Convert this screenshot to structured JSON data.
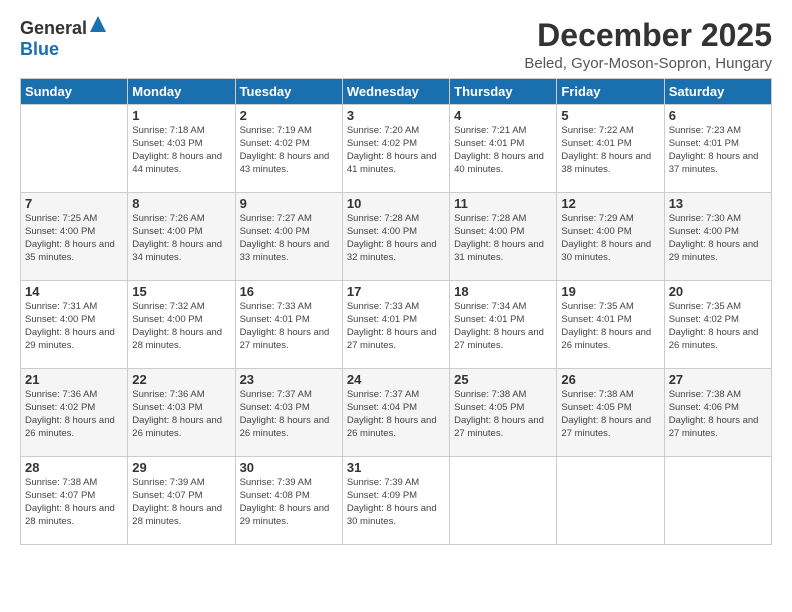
{
  "logo": {
    "general": "General",
    "blue": "Blue"
  },
  "title": "December 2025",
  "location": "Beled, Gyor-Moson-Sopron, Hungary",
  "weekdays": [
    "Sunday",
    "Monday",
    "Tuesday",
    "Wednesday",
    "Thursday",
    "Friday",
    "Saturday"
  ],
  "weeks": [
    [
      {
        "day": "",
        "sunrise": "",
        "sunset": "",
        "daylight": ""
      },
      {
        "day": "1",
        "sunrise": "Sunrise: 7:18 AM",
        "sunset": "Sunset: 4:03 PM",
        "daylight": "Daylight: 8 hours and 44 minutes."
      },
      {
        "day": "2",
        "sunrise": "Sunrise: 7:19 AM",
        "sunset": "Sunset: 4:02 PM",
        "daylight": "Daylight: 8 hours and 43 minutes."
      },
      {
        "day": "3",
        "sunrise": "Sunrise: 7:20 AM",
        "sunset": "Sunset: 4:02 PM",
        "daylight": "Daylight: 8 hours and 41 minutes."
      },
      {
        "day": "4",
        "sunrise": "Sunrise: 7:21 AM",
        "sunset": "Sunset: 4:01 PM",
        "daylight": "Daylight: 8 hours and 40 minutes."
      },
      {
        "day": "5",
        "sunrise": "Sunrise: 7:22 AM",
        "sunset": "Sunset: 4:01 PM",
        "daylight": "Daylight: 8 hours and 38 minutes."
      },
      {
        "day": "6",
        "sunrise": "Sunrise: 7:23 AM",
        "sunset": "Sunset: 4:01 PM",
        "daylight": "Daylight: 8 hours and 37 minutes."
      }
    ],
    [
      {
        "day": "7",
        "sunrise": "Sunrise: 7:25 AM",
        "sunset": "Sunset: 4:00 PM",
        "daylight": "Daylight: 8 hours and 35 minutes."
      },
      {
        "day": "8",
        "sunrise": "Sunrise: 7:26 AM",
        "sunset": "Sunset: 4:00 PM",
        "daylight": "Daylight: 8 hours and 34 minutes."
      },
      {
        "day": "9",
        "sunrise": "Sunrise: 7:27 AM",
        "sunset": "Sunset: 4:00 PM",
        "daylight": "Daylight: 8 hours and 33 minutes."
      },
      {
        "day": "10",
        "sunrise": "Sunrise: 7:28 AM",
        "sunset": "Sunset: 4:00 PM",
        "daylight": "Daylight: 8 hours and 32 minutes."
      },
      {
        "day": "11",
        "sunrise": "Sunrise: 7:28 AM",
        "sunset": "Sunset: 4:00 PM",
        "daylight": "Daylight: 8 hours and 31 minutes."
      },
      {
        "day": "12",
        "sunrise": "Sunrise: 7:29 AM",
        "sunset": "Sunset: 4:00 PM",
        "daylight": "Daylight: 8 hours and 30 minutes."
      },
      {
        "day": "13",
        "sunrise": "Sunrise: 7:30 AM",
        "sunset": "Sunset: 4:00 PM",
        "daylight": "Daylight: 8 hours and 29 minutes."
      }
    ],
    [
      {
        "day": "14",
        "sunrise": "Sunrise: 7:31 AM",
        "sunset": "Sunset: 4:00 PM",
        "daylight": "Daylight: 8 hours and 29 minutes."
      },
      {
        "day": "15",
        "sunrise": "Sunrise: 7:32 AM",
        "sunset": "Sunset: 4:00 PM",
        "daylight": "Daylight: 8 hours and 28 minutes."
      },
      {
        "day": "16",
        "sunrise": "Sunrise: 7:33 AM",
        "sunset": "Sunset: 4:01 PM",
        "daylight": "Daylight: 8 hours and 27 minutes."
      },
      {
        "day": "17",
        "sunrise": "Sunrise: 7:33 AM",
        "sunset": "Sunset: 4:01 PM",
        "daylight": "Daylight: 8 hours and 27 minutes."
      },
      {
        "day": "18",
        "sunrise": "Sunrise: 7:34 AM",
        "sunset": "Sunset: 4:01 PM",
        "daylight": "Daylight: 8 hours and 27 minutes."
      },
      {
        "day": "19",
        "sunrise": "Sunrise: 7:35 AM",
        "sunset": "Sunset: 4:01 PM",
        "daylight": "Daylight: 8 hours and 26 minutes."
      },
      {
        "day": "20",
        "sunrise": "Sunrise: 7:35 AM",
        "sunset": "Sunset: 4:02 PM",
        "daylight": "Daylight: 8 hours and 26 minutes."
      }
    ],
    [
      {
        "day": "21",
        "sunrise": "Sunrise: 7:36 AM",
        "sunset": "Sunset: 4:02 PM",
        "daylight": "Daylight: 8 hours and 26 minutes."
      },
      {
        "day": "22",
        "sunrise": "Sunrise: 7:36 AM",
        "sunset": "Sunset: 4:03 PM",
        "daylight": "Daylight: 8 hours and 26 minutes."
      },
      {
        "day": "23",
        "sunrise": "Sunrise: 7:37 AM",
        "sunset": "Sunset: 4:03 PM",
        "daylight": "Daylight: 8 hours and 26 minutes."
      },
      {
        "day": "24",
        "sunrise": "Sunrise: 7:37 AM",
        "sunset": "Sunset: 4:04 PM",
        "daylight": "Daylight: 8 hours and 26 minutes."
      },
      {
        "day": "25",
        "sunrise": "Sunrise: 7:38 AM",
        "sunset": "Sunset: 4:05 PM",
        "daylight": "Daylight: 8 hours and 27 minutes."
      },
      {
        "day": "26",
        "sunrise": "Sunrise: 7:38 AM",
        "sunset": "Sunset: 4:05 PM",
        "daylight": "Daylight: 8 hours and 27 minutes."
      },
      {
        "day": "27",
        "sunrise": "Sunrise: 7:38 AM",
        "sunset": "Sunset: 4:06 PM",
        "daylight": "Daylight: 8 hours and 27 minutes."
      }
    ],
    [
      {
        "day": "28",
        "sunrise": "Sunrise: 7:38 AM",
        "sunset": "Sunset: 4:07 PM",
        "daylight": "Daylight: 8 hours and 28 minutes."
      },
      {
        "day": "29",
        "sunrise": "Sunrise: 7:39 AM",
        "sunset": "Sunset: 4:07 PM",
        "daylight": "Daylight: 8 hours and 28 minutes."
      },
      {
        "day": "30",
        "sunrise": "Sunrise: 7:39 AM",
        "sunset": "Sunset: 4:08 PM",
        "daylight": "Daylight: 8 hours and 29 minutes."
      },
      {
        "day": "31",
        "sunrise": "Sunrise: 7:39 AM",
        "sunset": "Sunset: 4:09 PM",
        "daylight": "Daylight: 8 hours and 30 minutes."
      },
      {
        "day": "",
        "sunrise": "",
        "sunset": "",
        "daylight": ""
      },
      {
        "day": "",
        "sunrise": "",
        "sunset": "",
        "daylight": ""
      },
      {
        "day": "",
        "sunrise": "",
        "sunset": "",
        "daylight": ""
      }
    ]
  ]
}
